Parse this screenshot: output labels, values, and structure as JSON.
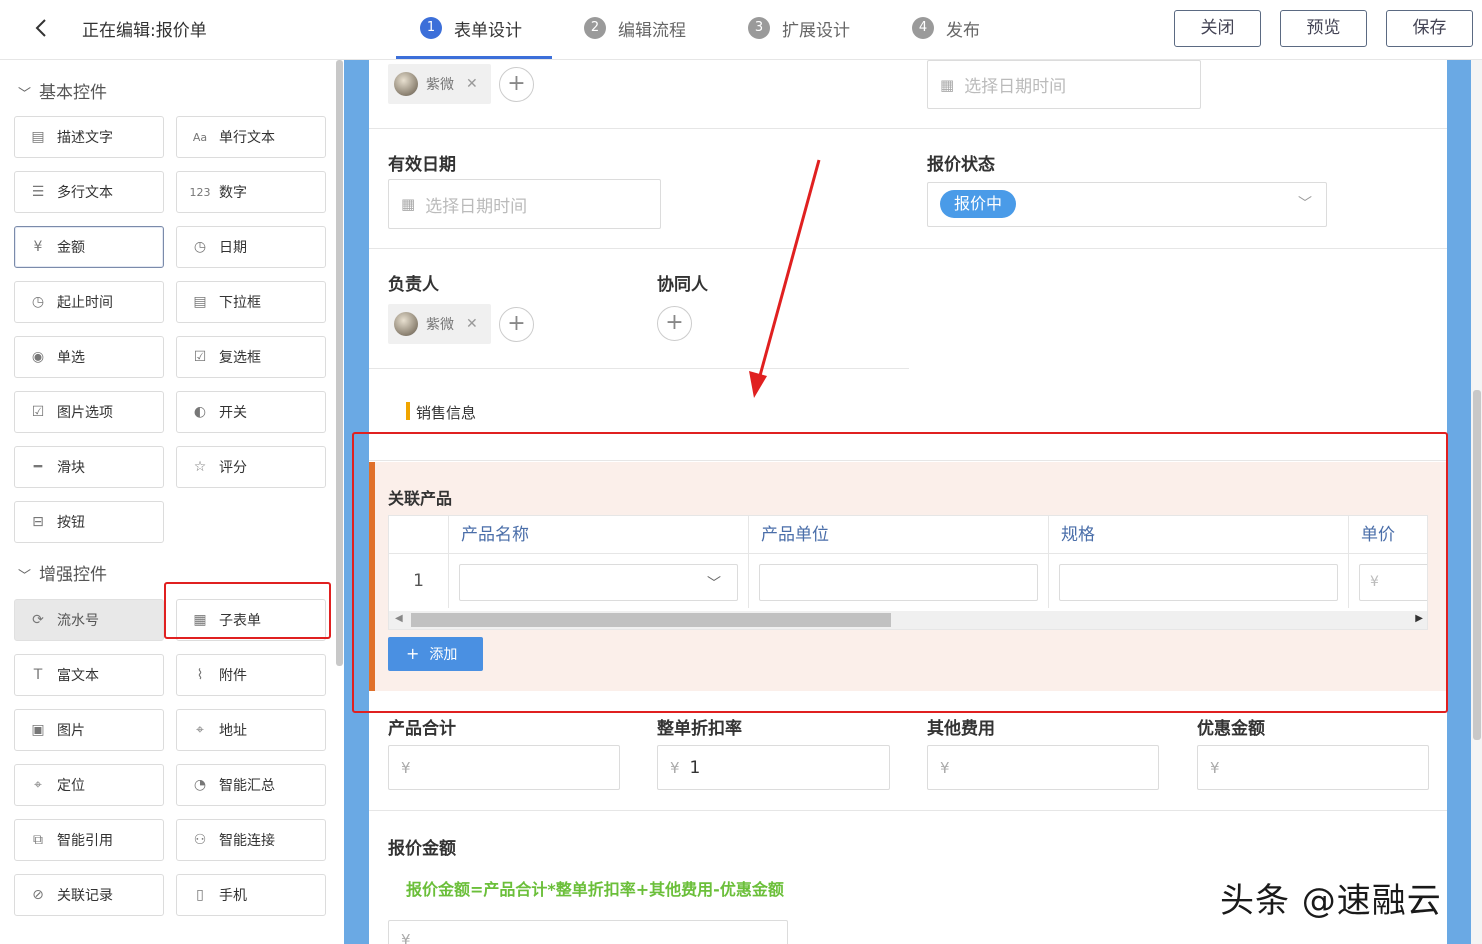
{
  "header": {
    "back_icon": "chevron-left-icon",
    "title": "正在编辑:报价单",
    "steps": [
      {
        "num": "1",
        "label": "表单设计"
      },
      {
        "num": "2",
        "label": "编辑流程"
      },
      {
        "num": "3",
        "label": "扩展设计"
      },
      {
        "num": "4",
        "label": "发布"
      }
    ],
    "active_step": 0,
    "close_label": "关闭",
    "preview_label": "预览",
    "save_label": "保存"
  },
  "sidebar": {
    "basic_title": "基本控件",
    "basic_items": [
      {
        "label": "描述文字",
        "icon": "document-lines-icon"
      },
      {
        "label": "单行文本",
        "icon": "text-aa-icon"
      },
      {
        "label": "多行文本",
        "icon": "multiline-list-icon"
      },
      {
        "label": "数字",
        "icon": "number-123-icon"
      },
      {
        "label": "金额",
        "icon": "yen-circle-icon"
      },
      {
        "label": "日期",
        "icon": "clock-icon"
      },
      {
        "label": "起止时间",
        "icon": "clock-icon"
      },
      {
        "label": "下拉框",
        "icon": "dropdown-list-icon"
      },
      {
        "label": "单选",
        "icon": "radio-icon"
      },
      {
        "label": "复选框",
        "icon": "checkbox-icon"
      },
      {
        "label": "图片选项",
        "icon": "image-check-icon"
      },
      {
        "label": "开关",
        "icon": "toggle-icon"
      },
      {
        "label": "滑块",
        "icon": "slider-icon"
      },
      {
        "label": "评分",
        "icon": "star-icon"
      },
      {
        "label": "按钮",
        "icon": "button-icon"
      }
    ],
    "enhanced_title": "增强控件",
    "enhanced_items": [
      {
        "label": "流水号",
        "icon": "serial-number-icon"
      },
      {
        "label": "子表单",
        "icon": "table-grid-icon"
      },
      {
        "label": "富文本",
        "icon": "rich-text-icon"
      },
      {
        "label": "附件",
        "icon": "paperclip-icon"
      },
      {
        "label": "图片",
        "icon": "picture-icon"
      },
      {
        "label": "地址",
        "icon": "address-pin-icon"
      },
      {
        "label": "定位",
        "icon": "location-pin-icon"
      },
      {
        "label": "智能汇总",
        "icon": "pie-chart-icon"
      },
      {
        "label": "智能引用",
        "icon": "reference-icon"
      },
      {
        "label": "智能连接",
        "icon": "connection-icon"
      },
      {
        "label": "关联记录",
        "icon": "link-record-icon"
      },
      {
        "label": "手机",
        "icon": "mobile-phone-icon"
      }
    ]
  },
  "form": {
    "top_user": "紫微",
    "top_date_placeholder": "选择日期时间",
    "valid_date_label": "有效日期",
    "valid_date_placeholder": "选择日期时间",
    "status_label": "报价状态",
    "status_value": "报价中",
    "owner_label": "负责人",
    "owner_user": "紫微",
    "collab_label": "协同人",
    "section_label": "销售信息",
    "subform": {
      "title": "关联产品",
      "columns": [
        "产品名称",
        "产品单位",
        "规格",
        "单价"
      ],
      "row_index": "1",
      "price_prefix": "¥",
      "add_label": "添加"
    },
    "totals": [
      {
        "label": "产品合计",
        "prefix": "¥",
        "value": ""
      },
      {
        "label": "整单折扣率",
        "prefix": "¥",
        "value": "1"
      },
      {
        "label": "其他费用",
        "prefix": "¥",
        "value": ""
      },
      {
        "label": "优惠金额",
        "prefix": "¥",
        "value": ""
      }
    ],
    "quote_amount_label": "报价金额",
    "formula": "报价金额=产品合计*整单折扣率+其他费用-优惠金额",
    "quote_amount_prefix": "¥"
  },
  "watermark": "头条 @速融云",
  "colors": {
    "accent": "#3c6fd9",
    "annotation_red": "#e02020",
    "subform_bg": "#fbefea",
    "formula_green": "#6bbf3a"
  }
}
